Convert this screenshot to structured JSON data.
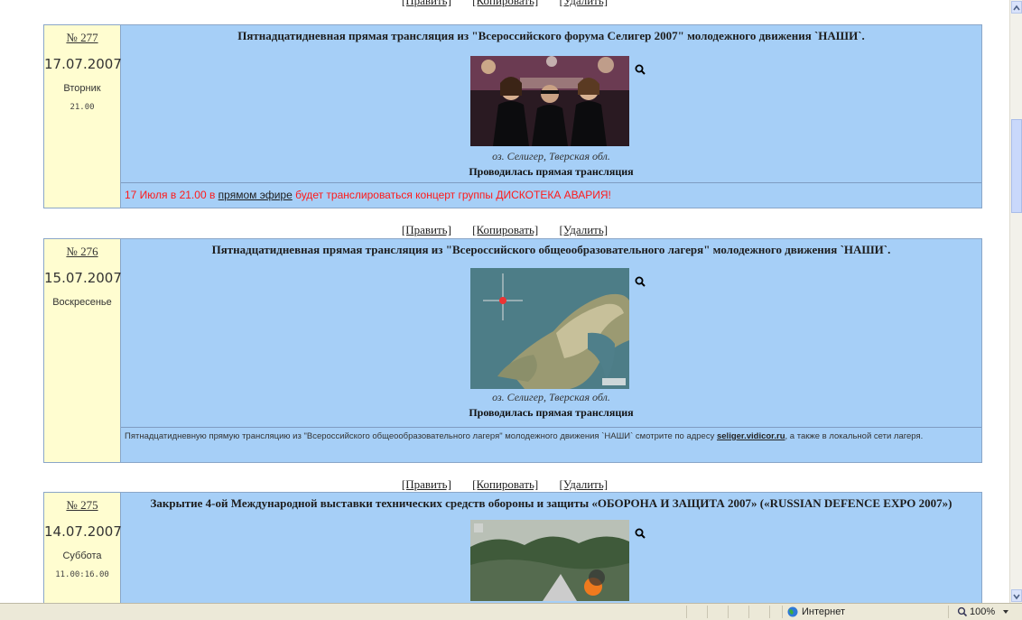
{
  "actions": {
    "edit": "[Править]",
    "copy": "[Копировать]",
    "delete": "[Удалить]"
  },
  "entries": [
    {
      "number": "№ 277",
      "date": "17.07.2007",
      "weekday": "Вторник",
      "time": "21.00",
      "title": "Пятнадцатидневная прямая трансляция из \"Всероссийского форума Селигер 2007\" молодежного движения `НАШИ`.",
      "caption": "оз. Селигер, Тверская обл.",
      "status": "Проводилась прямая трансляция",
      "note_before": "17 Июля в 21.00 в ",
      "note_link": "прямом эфире",
      "note_after": " будет транслироваться концерт группы ДИСКОТЕКА АВАРИЯ!"
    },
    {
      "number": "№ 276",
      "date": "15.07.2007",
      "weekday": "Воскресенье",
      "time": "",
      "title": "Пятнадцатидневная прямая трансляция из \"Всероссийского общеообразовательного лагеря\" молодежного движения `НАШИ`.",
      "caption": "оз. Селигер, Тверская обл.",
      "status": "Проводилась прямая трансляция",
      "note_before": "Пятнадцатидневную прямую трансляцию из \"Всероссийского общеообразовательного лагеря\" молодежного движения `НАШИ` смотрите по адресу ",
      "note_link": "seliger.vidicor.ru",
      "note_after": ", а также в локальной сети лагеря."
    },
    {
      "number": "№ 275",
      "date": "14.07.2007",
      "weekday": "Суббота",
      "time": "11.00:16.00",
      "title": "Закрытие 4-ой Международной выставки технических средств обороны и защиты «ОБОРОНА И ЗАЩИТА 2007» («RUSSIAN DEFENCE EXPO 2007»)"
    }
  ],
  "statusbar": {
    "zone": "Интернет",
    "zoom": "100%"
  },
  "icons": {
    "zoom": "magnifier-icon",
    "globe": "globe-icon"
  }
}
